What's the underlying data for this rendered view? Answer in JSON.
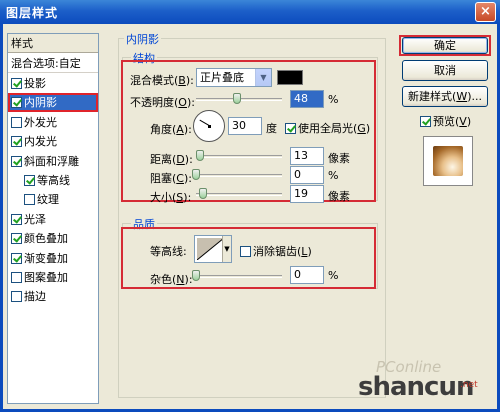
{
  "window": {
    "title": "图层样式",
    "close_glyph": "×"
  },
  "sidebar": {
    "header": "样式",
    "blend_options": "混合选项:自定",
    "items": [
      {
        "label": "投影",
        "checked": true
      },
      {
        "label": "内阴影",
        "checked": true,
        "selected": true
      },
      {
        "label": "外发光",
        "checked": false
      },
      {
        "label": "内发光",
        "checked": true
      },
      {
        "label": "斜面和浮雕",
        "checked": true
      },
      {
        "label": "等高线",
        "checked": true,
        "indent": true
      },
      {
        "label": "纹理",
        "checked": false,
        "indent": true
      },
      {
        "label": "光泽",
        "checked": true
      },
      {
        "label": "颜色叠加",
        "checked": true
      },
      {
        "label": "渐变叠加",
        "checked": true
      },
      {
        "label": "图案叠加",
        "checked": false
      },
      {
        "label": "描边",
        "checked": false
      }
    ]
  },
  "panel": {
    "title": "内阴影",
    "structure": {
      "title": "结构",
      "blend_mode_label": "混合模式(",
      "blend_mode_key": "B",
      "blend_mode_tail": "):",
      "blend_mode_value": "正片叠底",
      "blend_color": "#000000",
      "opacity_label": "不透明度(",
      "opacity_key": "O",
      "opacity_tail": "):",
      "opacity_value": "48",
      "opacity_unit": "%",
      "opacity_fraction": 0.48,
      "angle_label": "角度(",
      "angle_key": "A",
      "angle_tail": "):",
      "angle_value": "30",
      "angle_unit": "度",
      "global_light_label": "使用全局光(",
      "global_light_key": "G",
      "global_light_tail": ")",
      "global_light_checked": true,
      "distance_label": "距离(",
      "distance_key": "D",
      "distance_tail": "):",
      "distance_value": "13",
      "distance_unit": "像素",
      "distance_fraction": 0.05,
      "choke_label": "阻塞(",
      "choke_key": "C",
      "choke_tail": "):",
      "choke_value": "0",
      "choke_unit": "%",
      "choke_fraction": 0.0,
      "size_label": "大小(",
      "size_key": "S",
      "size_tail": "):",
      "size_value": "19",
      "size_unit": "像素",
      "size_fraction": 0.08
    },
    "quality": {
      "title": "品质",
      "contour_label": "等高线:",
      "antialias_label": "消除锯齿(",
      "antialias_key": "L",
      "antialias_tail": ")",
      "antialias_checked": false,
      "noise_label": "杂色(",
      "noise_key": "N",
      "noise_tail": "):",
      "noise_value": "0",
      "noise_unit": "%",
      "noise_fraction": 0.0
    }
  },
  "buttons": {
    "ok": "确定",
    "cancel": "取消",
    "new_style": "新建样式(",
    "new_style_key": "W",
    "new_style_tail": ")...",
    "preview_label": "预览(",
    "preview_key": "V",
    "preview_tail": ")",
    "preview_checked": true
  },
  "watermark": {
    "line1": "PConline",
    "line2": "shancun",
    "line3": ".net"
  }
}
